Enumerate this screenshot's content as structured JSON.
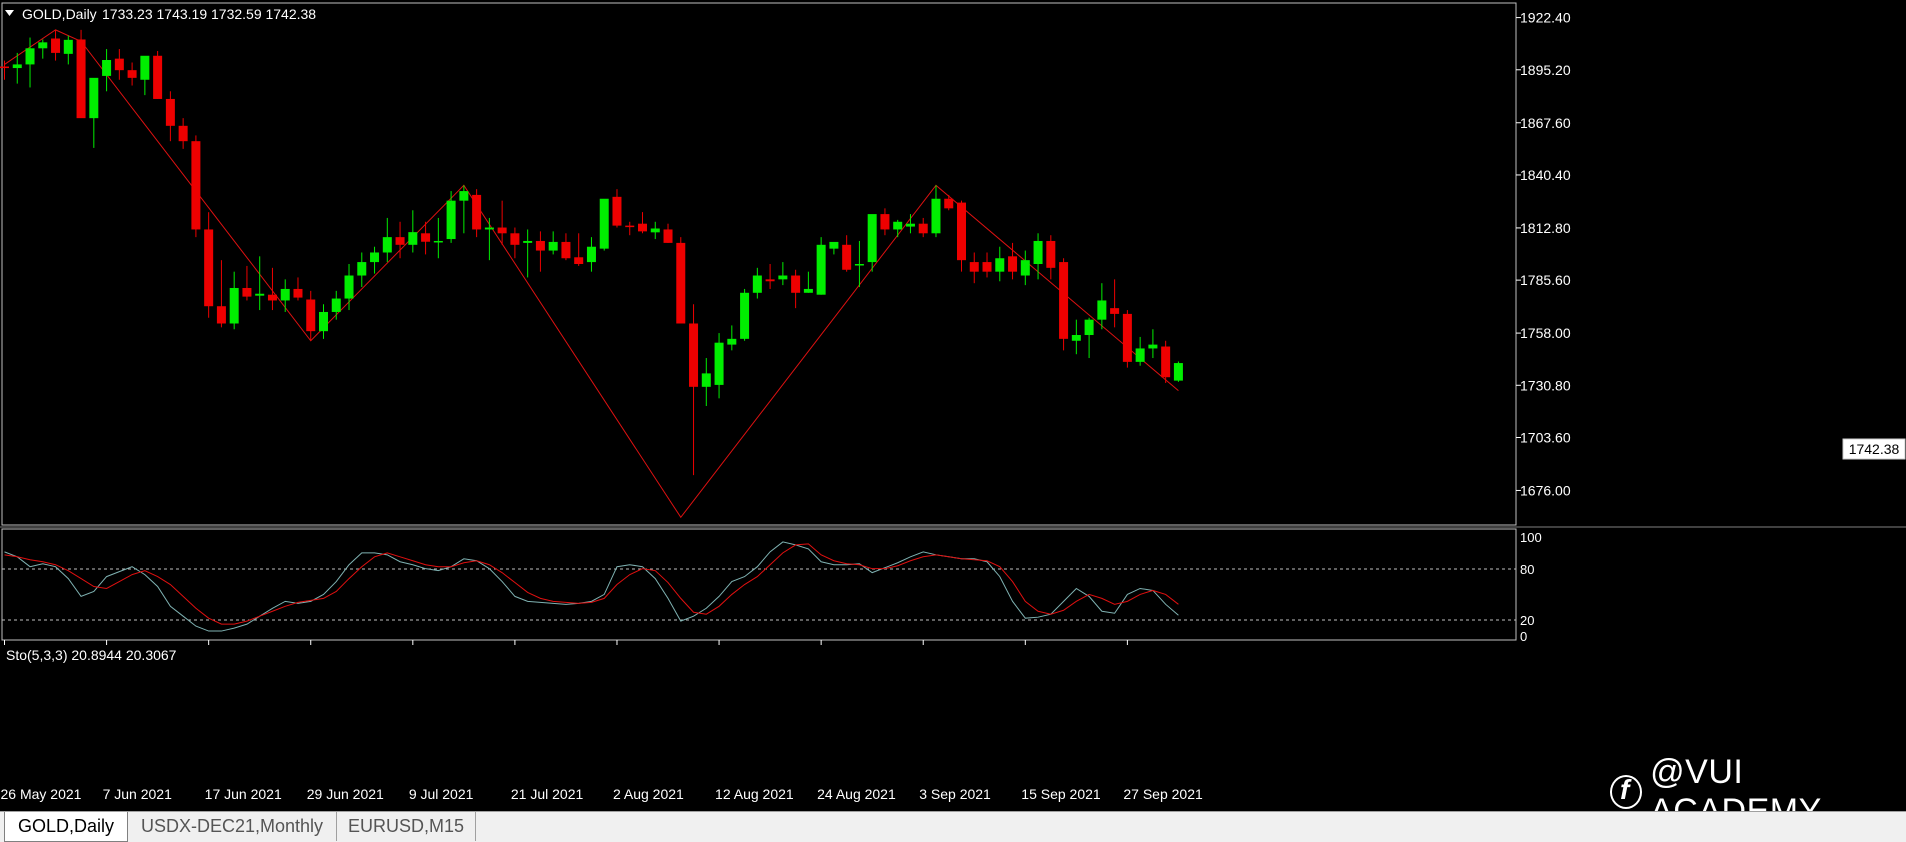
{
  "main_header": {
    "symbol": "GOLD,Daily",
    "ohlc": "1733.23 1743.19 1732.59 1742.38"
  },
  "sub_header": {
    "label": "Sto(5,3,3) 20.8944 20.3067"
  },
  "current_price_label": "1742.38",
  "colors": {
    "bull": "#00ee00",
    "bear": "#ee0000",
    "zigzag": "#dd1111",
    "sto_main": "#7fb2b2",
    "sto_signal": "#e01010",
    "axis_text": "#ffffff",
    "frame": "#c0c0c0"
  },
  "tabs": [
    "GOLD,Daily",
    "USDX-DEC21,Monthly",
    "EURUSD,M15"
  ],
  "watermark": "@VUI ACADEMY",
  "chart_data": [
    {
      "type": "candlestick",
      "title": "GOLD,Daily",
      "ylim": [
        1658.0,
        1930.0
      ],
      "y_ticks": [
        1922.4,
        1895.2,
        1867.6,
        1840.4,
        1812.8,
        1785.6,
        1758.0,
        1730.8,
        1703.6,
        1676.0
      ],
      "x_tick_labels": [
        "26 May 2021",
        "7 Jun 2021",
        "17 Jun 2021",
        "29 Jun 2021",
        "9 Jul 2021",
        "21 Jul 2021",
        "2 Aug 2021",
        "12 Aug 2021",
        "24 Aug 2021",
        "3 Sep 2021",
        "15 Sep 2021",
        "27 Sep 2021"
      ],
      "x_tick_index": [
        0,
        8,
        16,
        24,
        32,
        40,
        48,
        56,
        64,
        72,
        80,
        88
      ],
      "ohlc": [
        [
          1896.9,
          1900.0,
          1890.0,
          1896.1
        ],
        [
          1896.1,
          1904.0,
          1888.0,
          1898.0
        ],
        [
          1898.0,
          1912.0,
          1886.0,
          1906.4
        ],
        [
          1906.4,
          1911.0,
          1901.0,
          1909.5
        ],
        [
          1911.5,
          1916.0,
          1900.0,
          1904.0
        ],
        [
          1903.5,
          1913.0,
          1898.0,
          1910.8
        ],
        [
          1911.0,
          1916.0,
          1872.0,
          1870.0
        ],
        [
          1870.0,
          1888.0,
          1854.5,
          1891.0
        ],
        [
          1892.0,
          1906.0,
          1884.0,
          1900.3
        ],
        [
          1901.0,
          1906.0,
          1890.0,
          1895.0
        ],
        [
          1895.0,
          1899.0,
          1887.0,
          1891.0
        ],
        [
          1890.0,
          1902.0,
          1882.0,
          1902.5
        ],
        [
          1902.5,
          1905.0,
          1880.0,
          1880.0
        ],
        [
          1880.0,
          1884.0,
          1858.0,
          1866.0
        ],
        [
          1866.0,
          1870.0,
          1854.0,
          1858.0
        ],
        [
          1858.0,
          1861.0,
          1808.0,
          1812.0
        ],
        [
          1812.0,
          1821.0,
          1766.0,
          1772.0
        ],
        [
          1772.0,
          1796.0,
          1761.0,
          1763.0
        ],
        [
          1763.0,
          1790.0,
          1760.0,
          1781.5
        ],
        [
          1781.5,
          1793.0,
          1775.0,
          1777.0
        ],
        [
          1777.5,
          1798.0,
          1770.0,
          1778.5
        ],
        [
          1778.0,
          1792.0,
          1770.0,
          1775.0
        ],
        [
          1775.0,
          1786.0,
          1769.0,
          1781.0
        ],
        [
          1781.0,
          1787.0,
          1775.0,
          1776.5
        ],
        [
          1775.5,
          1780.0,
          1754.0,
          1759.0
        ],
        [
          1759.0,
          1773.0,
          1755.0,
          1769.0
        ],
        [
          1769.0,
          1780.0,
          1765.0,
          1776.0
        ],
        [
          1776.0,
          1794.0,
          1770.0,
          1788.0
        ],
        [
          1788.0,
          1800.0,
          1782.0,
          1795.0
        ],
        [
          1795.0,
          1803.0,
          1789.0,
          1800.0
        ],
        [
          1800.0,
          1818.0,
          1795.0,
          1808.0
        ],
        [
          1808.0,
          1816.0,
          1797.0,
          1804.0
        ],
        [
          1804.0,
          1822.0,
          1800.0,
          1810.6
        ],
        [
          1810.0,
          1816.0,
          1799.0,
          1805.6
        ],
        [
          1806.0,
          1818.0,
          1797.0,
          1806.0
        ],
        [
          1807.0,
          1832.0,
          1805.0,
          1827.0
        ],
        [
          1827.0,
          1835.0,
          1810.0,
          1832.0
        ],
        [
          1830.0,
          1833.0,
          1808.0,
          1812.0
        ],
        [
          1812.0,
          1818.0,
          1796.0,
          1813.0
        ],
        [
          1813.0,
          1827.0,
          1804.0,
          1810.0
        ],
        [
          1810.0,
          1813.0,
          1797.0,
          1804.0
        ],
        [
          1805.0,
          1812.0,
          1787.0,
          1806.0
        ],
        [
          1806.0,
          1811.0,
          1790.0,
          1801.0
        ],
        [
          1801.0,
          1811.0,
          1799.0,
          1805.5
        ],
        [
          1805.5,
          1810.0,
          1796.0,
          1797.0
        ],
        [
          1797.5,
          1810.0,
          1793.0,
          1794.0
        ],
        [
          1795.0,
          1808.0,
          1790.0,
          1803.0
        ],
        [
          1802.0,
          1820.0,
          1801.0,
          1828.0
        ],
        [
          1829.0,
          1833.0,
          1813.0,
          1814.0
        ],
        [
          1814.0,
          1816.0,
          1809.0,
          1813.5
        ],
        [
          1815.0,
          1821.0,
          1810.0,
          1811.0
        ],
        [
          1810.5,
          1816.0,
          1807.0,
          1812.5
        ],
        [
          1812.0,
          1815.0,
          1805.0,
          1805.0
        ],
        [
          1805.0,
          1808.0,
          1763.0,
          1763.0
        ],
        [
          1763.0,
          1773.0,
          1684.0,
          1730.0
        ],
        [
          1730.0,
          1745.0,
          1720.0,
          1737.0
        ],
        [
          1731.0,
          1758.0,
          1724.0,
          1753.0
        ],
        [
          1752.0,
          1762.0,
          1749.0,
          1755.0
        ],
        [
          1755.0,
          1781.0,
          1754.0,
          1779.0
        ],
        [
          1779.0,
          1792.0,
          1776.0,
          1788.0
        ],
        [
          1786.0,
          1794.0,
          1781.0,
          1785.0
        ],
        [
          1786.0,
          1795.0,
          1783.0,
          1788.0
        ],
        [
          1788.0,
          1791.0,
          1771.0,
          1779.0
        ],
        [
          1779.0,
          1790.0,
          1779.0,
          1781.0
        ],
        [
          1778.0,
          1808.0,
          1778.0,
          1804.0
        ],
        [
          1802.0,
          1805.0,
          1799.0,
          1805.5
        ],
        [
          1804.0,
          1809.0,
          1790.0,
          1791.0
        ],
        [
          1794.0,
          1806.0,
          1782.0,
          1794.0
        ],
        [
          1795.0,
          1818.0,
          1790.0,
          1820.0
        ],
        [
          1820.0,
          1823.0,
          1809.0,
          1812.0
        ],
        [
          1812.0,
          1817.0,
          1808.0,
          1816.0
        ],
        [
          1813.5,
          1820.0,
          1810.0,
          1815.0
        ],
        [
          1815.0,
          1818.0,
          1808.0,
          1810.0
        ],
        [
          1810.0,
          1835.0,
          1808.0,
          1828.0
        ],
        [
          1828.0,
          1830.0,
          1822.0,
          1823.0
        ],
        [
          1826.0,
          1827.0,
          1790.0,
          1796.0
        ],
        [
          1795.0,
          1800.0,
          1784.0,
          1790.0
        ],
        [
          1795.0,
          1800.0,
          1787.0,
          1790.0
        ],
        [
          1790.0,
          1803.0,
          1785.0,
          1797.0
        ],
        [
          1798.0,
          1805.0,
          1786.0,
          1790.0
        ],
        [
          1788.0,
          1801.0,
          1783.0,
          1796.0
        ],
        [
          1794.0,
          1810.0,
          1786.0,
          1806.0
        ],
        [
          1806.0,
          1809.0,
          1786.0,
          1792.0
        ],
        [
          1795.0,
          1797.0,
          1749.0,
          1755.0
        ],
        [
          1754.0,
          1765.0,
          1747.0,
          1757.0
        ],
        [
          1757.0,
          1766.0,
          1745.0,
          1765.0
        ],
        [
          1765.0,
          1784.0,
          1760.0,
          1775.0
        ],
        [
          1771.0,
          1786.0,
          1761.0,
          1768.0
        ],
        [
          1768.0,
          1770.0,
          1740.0,
          1743.0
        ],
        [
          1743.0,
          1756.0,
          1741.0,
          1750.0
        ],
        [
          1750.0,
          1760.0,
          1745.0,
          1752.0
        ],
        [
          1751.0,
          1754.0,
          1732.0,
          1735.0
        ],
        [
          1733.23,
          1743.19,
          1732.59,
          1742.38
        ]
      ],
      "zigzag": [
        [
          0,
          1898.0
        ],
        [
          4,
          1916.0
        ],
        [
          6,
          1910.0
        ],
        [
          24,
          1754.0
        ],
        [
          36,
          1835.0
        ],
        [
          53,
          1662.0
        ],
        [
          73,
          1835.0
        ],
        [
          92,
          1728.0
        ]
      ]
    },
    {
      "type": "line",
      "title": "Sto(5,3,3) 20.8944 20.3067",
      "ylim": [
        0,
        100
      ],
      "y_ticks": [
        100,
        80,
        20,
        0
      ],
      "levels": [
        80,
        20
      ],
      "series": [
        {
          "name": "main",
          "values": [
            85,
            80,
            70,
            73,
            70,
            58,
            40,
            45,
            60,
            65,
            70,
            62,
            50,
            30,
            20,
            10,
            5,
            5,
            8,
            12,
            20,
            28,
            35,
            33,
            35,
            42,
            55,
            72,
            84,
            84,
            82,
            75,
            72,
            68,
            66,
            70,
            78,
            76,
            68,
            55,
            40,
            35,
            34,
            33,
            32,
            33,
            35,
            42,
            70,
            72,
            70,
            58,
            38,
            15,
            20,
            28,
            40,
            55,
            60,
            70,
            85,
            95,
            92,
            88,
            75,
            72,
            72,
            73,
            64,
            69,
            74,
            80,
            85,
            82,
            80,
            78,
            78,
            75,
            60,
            35,
            18,
            19,
            22,
            35,
            48,
            40,
            25,
            23,
            42,
            48,
            46,
            32,
            21
          ]
        },
        {
          "name": "signal",
          "values": [
            82,
            80,
            77,
            75,
            72,
            66,
            58,
            50,
            48,
            55,
            62,
            66,
            60,
            52,
            40,
            28,
            18,
            12,
            12,
            15,
            20,
            25,
            30,
            34,
            36,
            38,
            45,
            58,
            70,
            80,
            84,
            80,
            76,
            72,
            70,
            70,
            74,
            76,
            72,
            64,
            54,
            44,
            38,
            35,
            34,
            33,
            34,
            38,
            52,
            62,
            68,
            66,
            54,
            38,
            24,
            22,
            30,
            42,
            52,
            60,
            72,
            84,
            92,
            93,
            82,
            76,
            73,
            72,
            68,
            68,
            71,
            76,
            80,
            82,
            80,
            78,
            77,
            76,
            70,
            55,
            35,
            25,
            22,
            26,
            35,
            42,
            38,
            32,
            35,
            42,
            46,
            42,
            32
          ]
        }
      ]
    }
  ]
}
